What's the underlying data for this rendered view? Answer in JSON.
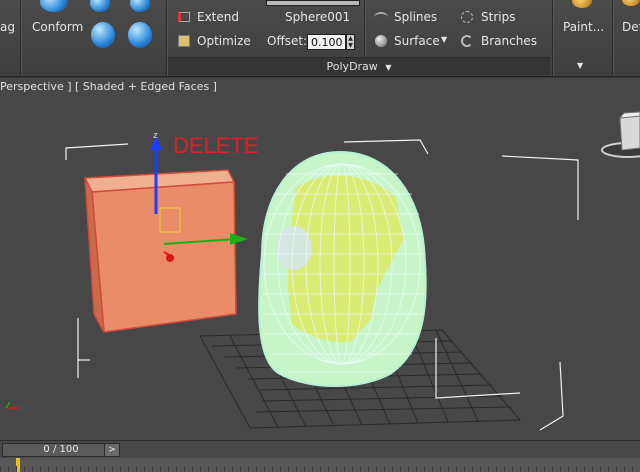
{
  "ribbon": {
    "partial_left_label": "ag",
    "conform_label": "Conform",
    "extend_label": "Extend",
    "optimize_label": "Optimize",
    "object_name": "Sphere001",
    "offset_label": "Offset:",
    "offset_value": "0.100",
    "splines_label": "Splines",
    "surface_label": "Surface",
    "strips_label": "Strips",
    "branches_label": "Branches",
    "paint_label": "Paint...",
    "partial_right_label": "Def",
    "group_label": "PolyDraw"
  },
  "viewport": {
    "label": "Perspective ] [ Shaded + Edged Faces ]",
    "annotation": "DELETE",
    "gizmo_axis_label": "z"
  },
  "timeline": {
    "frame_display": "0 / 100",
    "next_symbol": ">"
  }
}
